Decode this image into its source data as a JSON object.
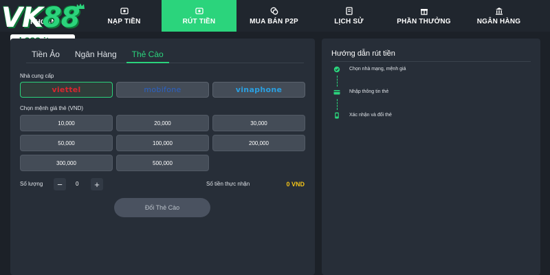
{
  "brand": {
    "logo_text_a": "VK",
    "logo_text_b": "88",
    "url": "vk888.it.com",
    "accent": "#2bd47c"
  },
  "nav": [
    {
      "label": "KHOẢN",
      "icon": "user-icon"
    },
    {
      "label": "NẠP TIỀN",
      "icon": "deposit-icon"
    },
    {
      "label": "RÚT TIỀN",
      "icon": "withdraw-icon",
      "active": true
    },
    {
      "label": "MUA BÁN P2P",
      "icon": "coins-icon"
    },
    {
      "label": "LỊCH SỬ",
      "icon": "history-icon"
    },
    {
      "label": "PHẦN THƯỞNG",
      "icon": "reward-icon"
    },
    {
      "label": "NGÂN HÀNG",
      "icon": "bank-icon"
    }
  ],
  "tabs": [
    "Tiền Ảo",
    "Ngân Hàng",
    "Thẻ Cào"
  ],
  "active_tab": "Thẻ Cào",
  "form": {
    "provider_label": "Nhà cung cấp",
    "providers": [
      "viettel",
      "mobifone",
      "vinaphone"
    ],
    "selected_provider": "viettel",
    "amount_label": "Chọn mệnh giá thẻ (VND)",
    "amounts": [
      "10,000",
      "20,000",
      "30,000",
      "50,000",
      "100,000",
      "200,000",
      "300,000",
      "500,000"
    ],
    "quantity_label": "Số lượng",
    "quantity_minus": "−",
    "quantity_value": "0",
    "quantity_plus": "+",
    "received_label": "Số tiền thực nhận",
    "received_value": "0 VND",
    "submit_label": "Đổi Thẻ Cào"
  },
  "guide": {
    "title": "Hướng dẫn rút tiền",
    "steps": [
      {
        "text": "Chọn nhà mạng, mệnh giá",
        "icon": "network-icon"
      },
      {
        "text": "Nhập thông tin thẻ",
        "icon": "card-icon"
      },
      {
        "text": "Xác nhận và đổi thẻ",
        "icon": "phone-icon"
      }
    ]
  }
}
